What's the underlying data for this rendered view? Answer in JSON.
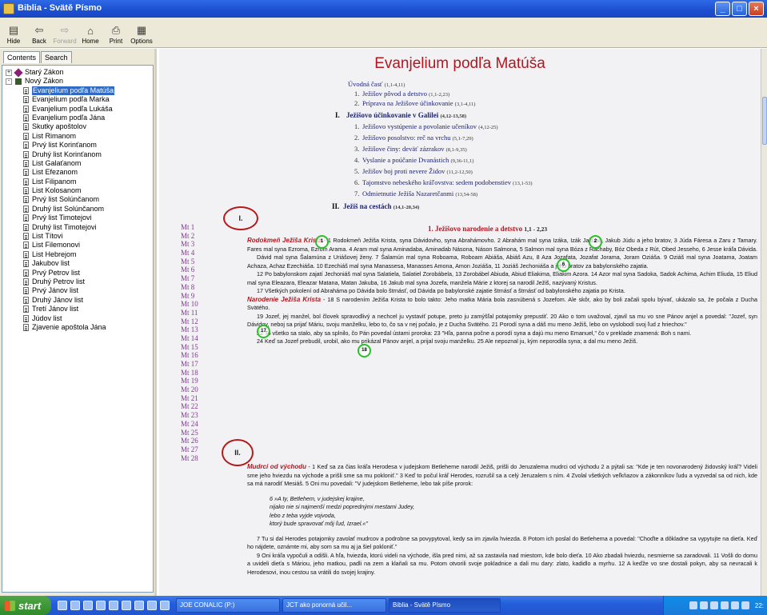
{
  "window": {
    "title": "Biblia - Svätě Písmo"
  },
  "toolbar": {
    "buttons": [
      {
        "label": "Hide",
        "icon": "hide-icon",
        "enabled": true
      },
      {
        "label": "Back",
        "icon": "back-arrow-icon",
        "enabled": true
      },
      {
        "label": "Forward",
        "icon": "forward-arrow-icon",
        "enabled": false
      },
      {
        "label": "Home",
        "icon": "home-icon",
        "enabled": true
      },
      {
        "label": "Print",
        "icon": "printer-icon",
        "enabled": true
      },
      {
        "label": "Options",
        "icon": "options-icon",
        "enabled": true
      }
    ]
  },
  "sidebar": {
    "tabs": [
      "Contents",
      "Search"
    ],
    "active_tab": "Contents",
    "tree": [
      {
        "label": "Starý Zákon",
        "level": 0,
        "type": "book-closed",
        "toggle": "+"
      },
      {
        "label": "Nový Zákon",
        "level": 0,
        "type": "book-open",
        "toggle": "-"
      },
      {
        "label": "Evanjelium podľa Matúša",
        "level": 1,
        "type": "page",
        "selected": true
      },
      {
        "label": "Evanjelium podľa Marka",
        "level": 1,
        "type": "page"
      },
      {
        "label": "Evanjelium podľa Lukáša",
        "level": 1,
        "type": "page"
      },
      {
        "label": "Evanjelium podľa Jána",
        "level": 1,
        "type": "page"
      },
      {
        "label": "Skutky apoštolov",
        "level": 1,
        "type": "page"
      },
      {
        "label": "List Rimanom",
        "level": 1,
        "type": "page"
      },
      {
        "label": "Prvý list Korinťanom",
        "level": 1,
        "type": "page"
      },
      {
        "label": "Druhý list Korinťanom",
        "level": 1,
        "type": "page"
      },
      {
        "label": "List Galaťanom",
        "level": 1,
        "type": "page"
      },
      {
        "label": "List Efezanom",
        "level": 1,
        "type": "page"
      },
      {
        "label": "List Filipanom",
        "level": 1,
        "type": "page"
      },
      {
        "label": "List Kolosanom",
        "level": 1,
        "type": "page"
      },
      {
        "label": "Prvý list Solúnčanom",
        "level": 1,
        "type": "page"
      },
      {
        "label": "Druhý list Solúnčanom",
        "level": 1,
        "type": "page"
      },
      {
        "label": "Prvý list Timotejovi",
        "level": 1,
        "type": "page"
      },
      {
        "label": "Druhý list Timotejovi",
        "level": 1,
        "type": "page"
      },
      {
        "label": "List Títovi",
        "level": 1,
        "type": "page"
      },
      {
        "label": "List Filemonovi",
        "level": 1,
        "type": "page"
      },
      {
        "label": "List Hebrejom",
        "level": 1,
        "type": "page"
      },
      {
        "label": "Jakubov list",
        "level": 1,
        "type": "page"
      },
      {
        "label": "Prvý Petrov list",
        "level": 1,
        "type": "page"
      },
      {
        "label": "Druhý Petrov list",
        "level": 1,
        "type": "page"
      },
      {
        "label": "Prvý Jánov list",
        "level": 1,
        "type": "page"
      },
      {
        "label": "Druhý Jánov list",
        "level": 1,
        "type": "page"
      },
      {
        "label": "Tretí Jánov list",
        "level": 1,
        "type": "page"
      },
      {
        "label": "Júdov list",
        "level": 1,
        "type": "page"
      },
      {
        "label": "Zjavenie apoštola Jána",
        "level": 1,
        "type": "page"
      }
    ]
  },
  "content": {
    "book_title": "Evanjelium podľa Matúša",
    "toc": {
      "intro": {
        "label": "Úvodná časť",
        "ref": "(1,1-4,11)"
      },
      "intro_items": [
        {
          "n": "1.",
          "label": "Ježišov pôvod a detstvo",
          "ref": "(1,1-2,23)"
        },
        {
          "n": "2.",
          "label": "Príprava na Ježišove účinkovanie",
          "ref": "(3,1-4,11)"
        }
      ],
      "sections": [
        {
          "n": "I.",
          "label": "Ježišovo účinkovanie v Galilei",
          "ref": "(4,12-13,58)"
        },
        {
          "n": "II.",
          "label": "Ježiš na cestách",
          "ref": "(14,1-20,34)"
        }
      ],
      "galilee_items": [
        {
          "n": "1.",
          "label": "Ježišovo vystúpenie a povolanie učeníkov",
          "ref": "(4,12-25)"
        },
        {
          "n": "2.",
          "label": "Ježišovo posolstvo: reč na vrchu",
          "ref": "(5,1-7,29)"
        },
        {
          "n": "3.",
          "label": "Ježišove činy: deväť zázrakov",
          "ref": "(8,1-9,35)"
        },
        {
          "n": "4.",
          "label": "Vyslanie a poúčanie Dvanástich",
          "ref": "(9,36-11,1)"
        },
        {
          "n": "5.",
          "label": "Ježišov boj proti nevere Židov",
          "ref": "(11,2-12,50)"
        },
        {
          "n": "6.",
          "label": "Tajomstvo nebeského kráľovstva: sedem podobenstiev",
          "ref": "(13,1-53)"
        },
        {
          "n": "7.",
          "label": "Odmietnutie Ježiša Nazaretčanmi",
          "ref": "(13,54-58)"
        }
      ]
    },
    "chapters": [
      "Mt 1",
      "Mt 2",
      "Mt 3",
      "Mt 4",
      "Mt 5",
      "Mt 6",
      "Mt 7",
      "Mt 8",
      "Mt 9",
      "Mt 10",
      "Mt 11",
      "Mt 12",
      "Mt 13",
      "Mt 14",
      "Mt 15",
      "Mt 16",
      "Mt 17",
      "Mt 18",
      "Mt 19",
      "Mt 20",
      "Mt 21",
      "Mt 22",
      "Mt 23",
      "Mt 24",
      "Mt 25",
      "Mt 26",
      "Mt 27",
      "Mt 28"
    ],
    "annotations": {
      "roman": [
        "I.",
        "II."
      ],
      "green": [
        "1",
        "2",
        "6",
        "17",
        "18"
      ]
    },
    "section1_title": "1. Ježišovo narodenie a detstvo",
    "section1_ref": "1,1 - 2,23",
    "heading_genealogy": "Rodokmeň Ježiša Krista",
    "heading_birth": "Narodenie Ježiša Krista",
    "heading_magi": "Mudrci od východu",
    "p1": "- 1 Rodokmeň Ježiša Krista, syna Dávidovho, syna Abrahámovho. 2 Abrahám mal syna Izáka, Izák Jakuba, Jakub Júdu a jeho bratov, 3 Júda Fáresa a Zaru z Tamary. Fares mal syna Ezroma, Ezrom Arama. 4 Aram mal syna Aminadaba, Aminadab Násona, Náson Salmona, 5 Salmon mal syna Bóza z Rachaby, Bóz Obeda z Rút, Obed Jesseho, 6 Jesse kráľa Dávida.",
    "p2": "Dávid mal syna Šalamúna z Uriášovej ženy. 7 Šalamún mal syna Roboama, Roboam Abiáša, Abiáš Azu, 8 Aza Jozafata, Jozafat Jorama, Joram Oziáša. 9 Oziáš mal syna Joatama, Joatam Achaza, Achaz Ezechiáša. 10 Ezechiáš mal syna Manassesa, Manasses Amona, Amon Joziáša, 11 Joziáš Jechoniáša a jeho bratov za babylonského zajatia.",
    "p3": "12 Po babylonskom zajatí Jechoniáš mal syna Salatiela, Salatiel Zorobábela, 13 Zorobábel Abiuda, Abiud Eliakima, Eliakim Azora. 14 Azor mal syna Sadoka, Sadok Achima, Achim Eliuda, 15 Eliud mal syna Eleazara, Eleazar Matana, Matan Jakuba, 16 Jakub mal syna Jozefa, manžela Márie z ktorej sa narodil Ježiš, nazývaný Kristus.",
    "p4": "17 Všetkých pokolení od Abraháma po Dávida bolo štrnásť, od Dávida po babylonské zajatie štrnásť a štrnásť od babylonského zajatia po Krista.",
    "p5": "- 18 S narodením Ježiša Krista to bolo takto: Jeho matka Mária bola zasnúbená s Jozefom. Ale skôr, ako by boli začali spolu bývať, ukázalo sa, že počala z Ducha Svätého.",
    "p6": "19 Jozef, jej manžel, bol človek spravodlivý a nechcel ju vystaviť potupe, preto ju zamýšľal potajomky prepustiť. 20 Ako o tom uvažoval, zjavil sa mu vo sne Pánov anjel a povedal: \"Jozef, syn Dávidov, neboj sa prijať Máriu, svoju manželku, lebo to, čo sa v nej počalo, je z Ducha Svätého. 21 Porodí syna a dáš mu meno Ježiš, lebo on vyslobodí svoj ľud z hriechov.\"",
    "p7": "22 To všetko sa stalo, aby sa splnilo, čo Pán povedal ústami proroka: 23 \"Hľa, panna počne a porodí syna a dajú mu meno Emanuel,\" čo v preklade znamená: Boh s nami.",
    "p8": "24 Keď sa Jozef prebudil, urobil, ako mu prikázal Pánov anjel, a prijal svoju manželku. 25 Ale nepoznal ju, kým neporodila syna; a dal mu meno Ježiš.",
    "p9": "- 1 Keď sa za čias kráľa Herodesa v judejskom Betleheme narodil Ježiš, prišli do Jeruzalema mudrci od východu 2 a pýtali sa: \"Kde je ten novonarodený židovský kráľ? Videli sme jeho hviezdu na východe a prišli sme sa mu pokloniť.\" 3 Keď to počul kráľ Herodes, rozrušil sa a celý Jeruzalem s ním. 4 Zvolal všetkých veľkňazov a zákonníkov ľudu a vyzvedal sa od nich, kde sa má narodiť Mesiáš. 5 Oni mu povedali: \"V judejskom Betleheme, lebo tak píše prorok:",
    "poem": [
      "6 »A ty, Betlehem, v judejskej krajine,",
      "nijako nie si najmenší medzi poprednými mestami Judey,",
      "lebo z teba vyjde vojvoda,",
      "ktorý bude spravovať môj ľud, Izrael.«\""
    ],
    "p10": "7 Tu si dal Herodes potajomky zavolať mudrcov a podrobne sa povypytoval, kedy sa im zjavila hviezda. 8 Potom ich poslal do Betlehema a povedal: \"Choďte a dôkladne sa vypytujte na dieťa. Keď ho nájdete, oznámte mi, aby som sa mu aj ja šiel pokloniť.\"",
    "p11": "9 Oni kráľa vypočuli a odišli. A hľa, hviezda, ktorú videli na východe, išla pred nimi, až sa zastavila nad miestom, kde bolo dieťa. 10 Ako zbadali hviezdu, nesmierne sa zaradovali. 11 Vošli do domu a uvideli dieťa s Máriou, jeho matkou, padli na zem a klaňali sa mu. Potom otvorili svoje pokladnice a dali mu dary: zlato, kadidlo a myrhu. 12 A keďže vo sne dostali pokyn, aby sa nevracali k Herodesovi, inou cestou sa vrátili do svojej krajiny."
  },
  "taskbar": {
    "start_label": "start",
    "tasks": [
      {
        "label": "JOE CONALIC (P:)",
        "active": false
      },
      {
        "label": "JCT ako ponorná učil...",
        "active": false
      },
      {
        "label": "Biblia - Svätě Písmo",
        "active": true
      }
    ],
    "clock": "22:"
  },
  "colors": {
    "title_red": "#b3161f",
    "selection": "#316ac5",
    "annotation_red": "#b31b1b",
    "annotation_green": "#2bbf2b"
  }
}
